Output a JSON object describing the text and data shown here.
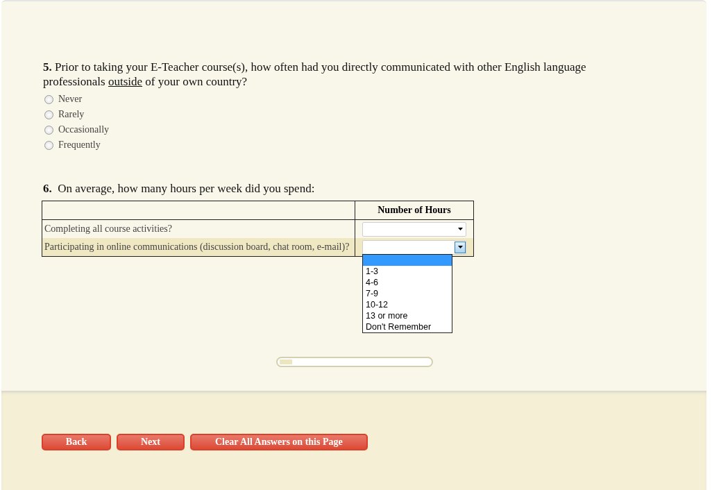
{
  "question5": {
    "number": "5.",
    "text_before": "Prior to taking your E-Teacher course(s), how often had you directly communicated with other English language professionals ",
    "underlined": "outside",
    "text_after": " of your own country?",
    "options": [
      {
        "label": "Never",
        "selected": false
      },
      {
        "label": "Rarely",
        "selected": false
      },
      {
        "label": "Occasionally",
        "selected": false
      },
      {
        "label": "Frequently",
        "selected": false
      }
    ]
  },
  "question6": {
    "number": "6.",
    "text": "On average, how many hours per week did you spend:",
    "column_header": "Number of Hours",
    "rows": [
      {
        "label": "Completing all course activities?",
        "open": false,
        "highlighted": false
      },
      {
        "label": "Participating in online communications (discussion board, chat room, e-mail)?",
        "open": true,
        "highlighted": true
      }
    ],
    "dropdown": {
      "blank_option_highlighted": true,
      "options": [
        "1-3",
        "4-6",
        "7-9",
        "10-12",
        "13 or more",
        "Don't Remember"
      ]
    }
  },
  "progress": {
    "level": 0.08
  },
  "buttons": [
    "Back",
    "Next",
    "Clear All Answers on this Page"
  ]
}
